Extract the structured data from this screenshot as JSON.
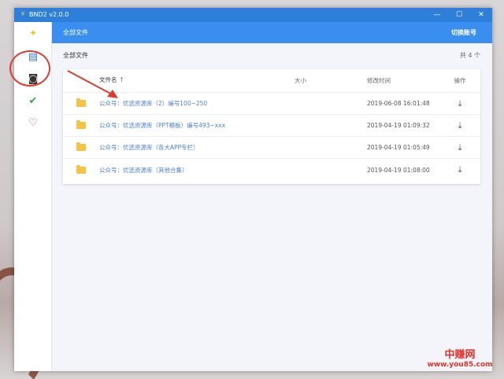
{
  "window": {
    "title": "BND2 v2.0.0",
    "min_glyph": "—",
    "max_glyph": "☐",
    "close_glyph": "✕"
  },
  "sidebar": {
    "items": [
      {
        "icon": "logo-icon",
        "glyph": "✦"
      },
      {
        "icon": "files-icon",
        "glyph": "▤"
      },
      {
        "icon": "download-icon",
        "glyph": "◙"
      },
      {
        "icon": "check-icon",
        "glyph": "✔"
      },
      {
        "icon": "heart-icon",
        "glyph": "♡"
      }
    ]
  },
  "header": {
    "title": "全部文件",
    "switch_account": "切换账号"
  },
  "breadcrumb": {
    "path": "全部文件",
    "count": "共 4 个"
  },
  "table": {
    "columns": {
      "name": "文件名",
      "size": "大小",
      "date": "修改时间",
      "op": "操作"
    },
    "sort_glyph": "🡑",
    "download_glyph": "⤓",
    "rows": [
      {
        "name": "公众号：优选资源库（2）编号100~250",
        "size": "",
        "date": "2019-06-08 16:01:48"
      },
      {
        "name": "公众号：优选资源库（PPT模板）编号493~xxx",
        "size": "",
        "date": "2019-04-19 01:09:32"
      },
      {
        "name": "公众号：优选资源库（各大APP专栏）",
        "size": "",
        "date": "2019-04-19 01:05:49"
      },
      {
        "name": "公众号：优选资源库（其他合集）",
        "size": "",
        "date": "2019-04-19 01:08:00"
      }
    ]
  },
  "watermark": {
    "brand": "中赚网",
    "url": "www.you85.com"
  },
  "colors": {
    "titlebar": "#2d7fd9",
    "header": "#3a8eef",
    "link": "#4c7fd2",
    "annotation": "#e03a2e"
  }
}
